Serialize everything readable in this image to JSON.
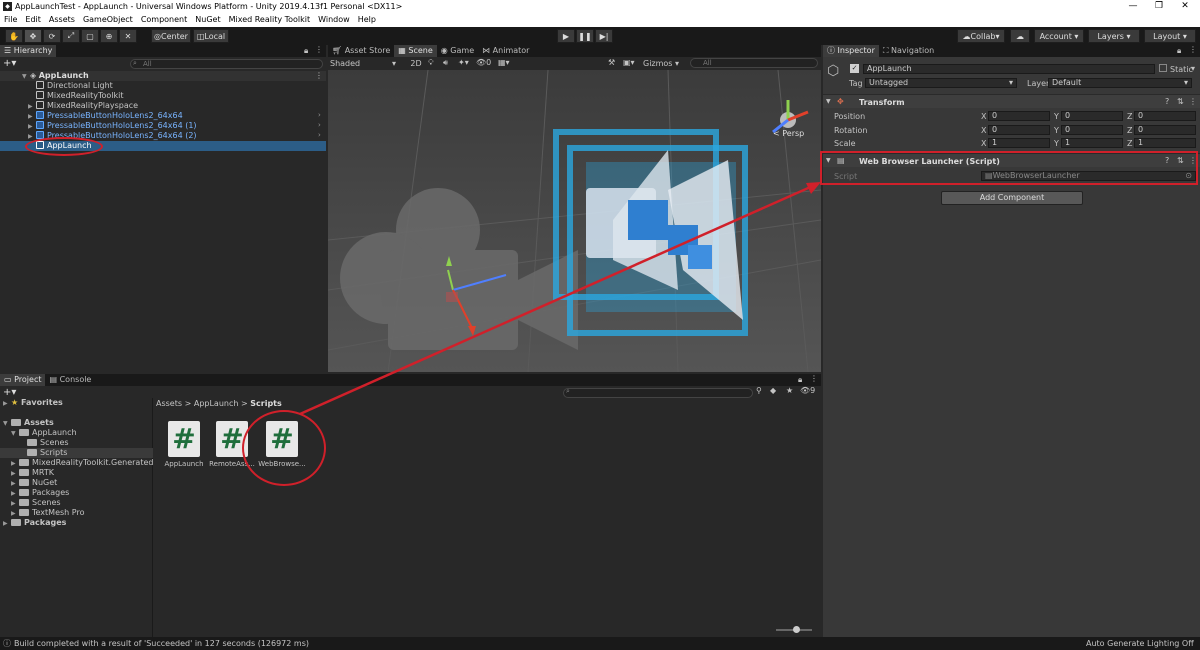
{
  "window": {
    "title": "AppLaunchTest - AppLaunch - Universal Windows Platform - Unity 2019.4.13f1 Personal <DX11>"
  },
  "menu": [
    "File",
    "Edit",
    "Assets",
    "GameObject",
    "Component",
    "NuGet",
    "Mixed Reality Toolkit",
    "Window",
    "Help"
  ],
  "toolbar": {
    "center": "Center",
    "local": "Local",
    "collab": "Collab",
    "account": "Account",
    "layers": "Layers",
    "layout": "Layout"
  },
  "hierarchy": {
    "tab": "Hierarchy",
    "search_placeholder": "All",
    "scene": "AppLaunch",
    "items": [
      "Directional Light",
      "MixedRealityToolkit",
      "MixedRealityPlayspace",
      "PressableButtonHoloLens2_64x64",
      "PressableButtonHoloLens2_64x64 (1)",
      "PressableButtonHoloLens2_64x64 (2)",
      "AppLaunch"
    ]
  },
  "scene": {
    "tabs": [
      "Asset Store",
      "Scene",
      "Game",
      "Animator"
    ],
    "shading": "Shaded",
    "mode2d": "2D",
    "layers_count": "0",
    "gizmos": "Gizmos",
    "search_placeholder": "All",
    "persp": "< Persp"
  },
  "inspector": {
    "tabs": [
      "Inspector",
      "Navigation"
    ],
    "object_name": "AppLaunch",
    "static_label": "Static",
    "tag_label": "Tag",
    "tag_value": "Untagged",
    "layer_label": "Layer",
    "layer_value": "Default",
    "transform": {
      "title": "Transform",
      "rows": [
        {
          "label": "Position",
          "x": "0",
          "y": "0",
          "z": "0"
        },
        {
          "label": "Rotation",
          "x": "0",
          "y": "0",
          "z": "0"
        },
        {
          "label": "Scale",
          "x": "1",
          "y": "1",
          "z": "1"
        }
      ]
    },
    "component": {
      "title": "Web Browser Launcher (Script)",
      "script_label": "Script",
      "script_value": "WebBrowserLauncher"
    },
    "add_component": "Add Component"
  },
  "project": {
    "tabs": [
      "Project",
      "Console"
    ],
    "favorites": "Favorites",
    "assets": "Assets",
    "tree": [
      "AppLaunch",
      "Scenes",
      "Scripts",
      "MixedRealityToolkit.Generated",
      "MRTK",
      "NuGet",
      "Packages",
      "Scenes",
      "TextMesh Pro"
    ],
    "packages": "Packages",
    "breadcrumb": [
      "Assets",
      "AppLaunch",
      "Scripts"
    ],
    "files": [
      "AppLaunch",
      "RemoteAss...",
      "WebBrowse..."
    ],
    "file_glyph": "#",
    "visible_count": "9"
  },
  "status": {
    "message": "Build completed with a result of 'Succeeded' in 127 seconds (126972 ms)",
    "right": "Auto Generate Lighting Off"
  },
  "colors": {
    "selection": "#2c5d87",
    "annotation": "#d0202a",
    "folder_accent": "#4fa3ff"
  }
}
